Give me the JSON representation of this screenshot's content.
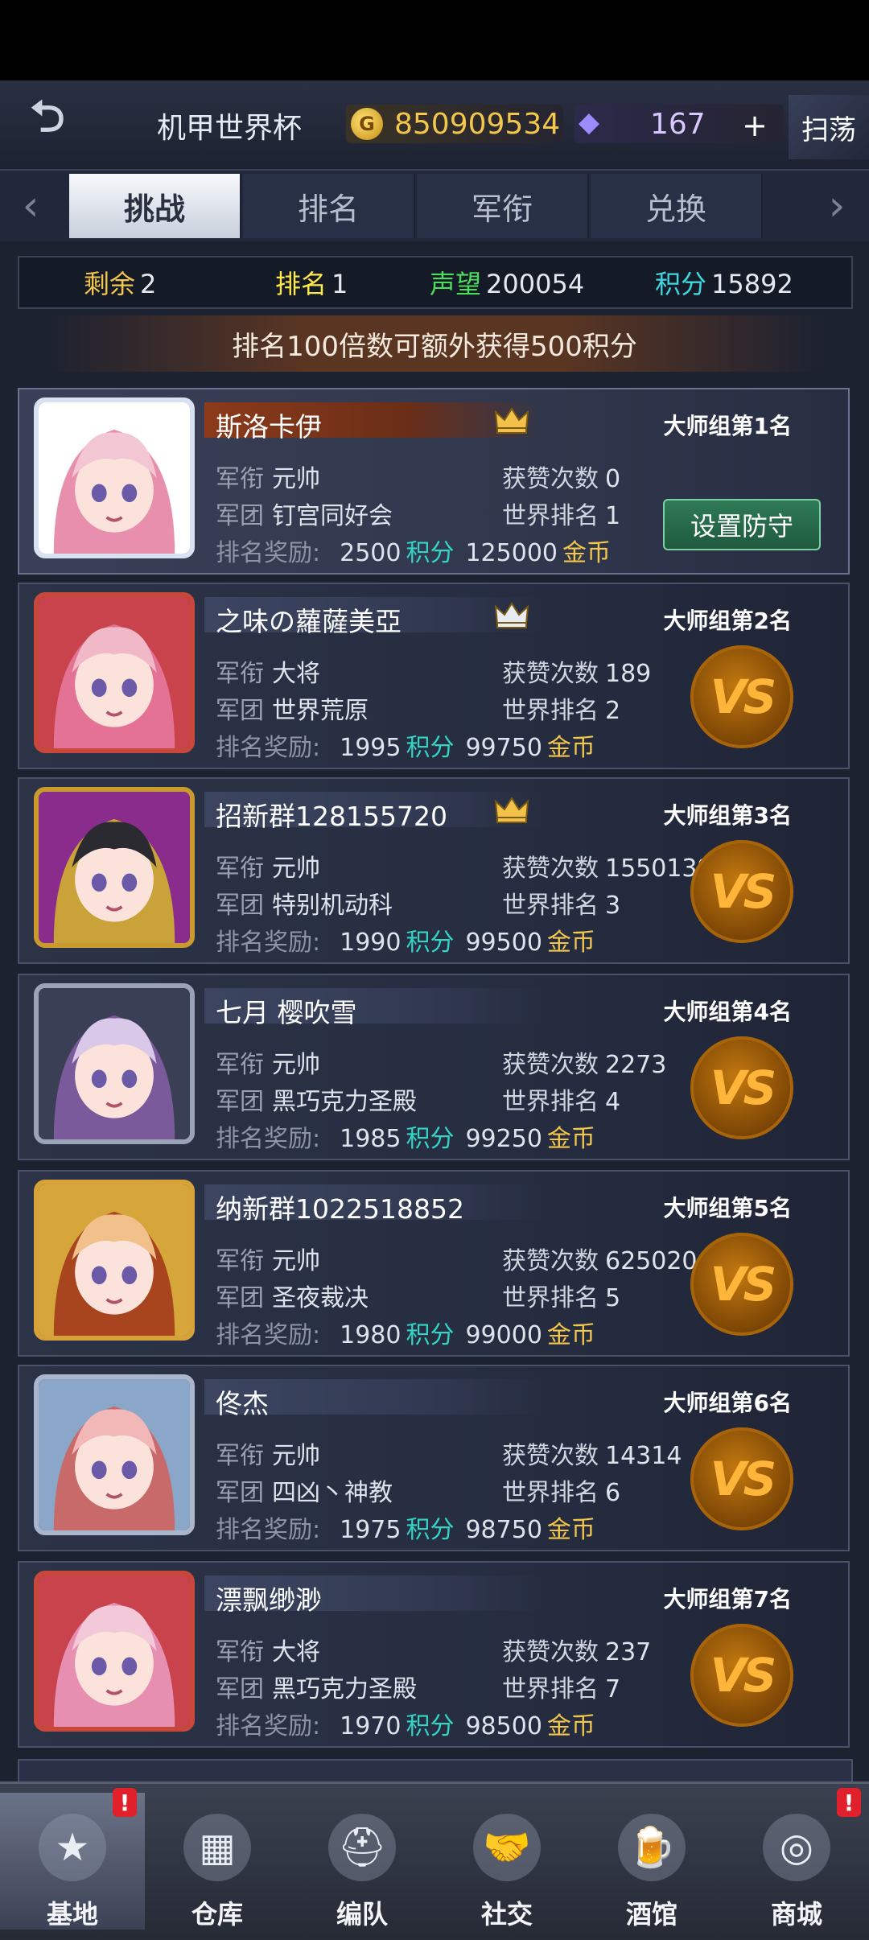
{
  "header": {
    "back_icon": "back-arrow-icon",
    "title": "机甲世界杯",
    "coins": "850909534",
    "gems": "167",
    "plus": "+",
    "sweep": "扫荡"
  },
  "tabs": [
    {
      "label": "挑战",
      "active": true
    },
    {
      "label": "排名",
      "active": false
    },
    {
      "label": "军衔",
      "active": false
    },
    {
      "label": "兑换",
      "active": false
    }
  ],
  "stats": {
    "remaining_label": "剩余",
    "remaining": "2",
    "rank_label": "排名",
    "rank": "1",
    "prestige_label": "声望",
    "prestige": "200054",
    "points_label": "积分",
    "points": "15892"
  },
  "notice": "排名100倍数可额外获得500积分",
  "labels": {
    "rank_title": "军衔",
    "legion": "军团",
    "likes": "获赞次数",
    "world_rank": "世界排名",
    "reward": "排名奖励:",
    "points_unit": "积分",
    "gold_unit": "金币",
    "vs": "VS",
    "set_defense": "设置防守"
  },
  "players": [
    {
      "name": "斯洛卡伊",
      "group": "大师组第1名",
      "title": "元帅",
      "legion": "钉宫同好会",
      "likes": "0",
      "world_rank": "1",
      "reward_points": "2500",
      "reward_gold": "125000",
      "crown": "1"
    },
    {
      "name": "之味の蘿薩美亞",
      "group": "大师组第2名",
      "title": "大将",
      "legion": "世界荒原",
      "likes": "189",
      "world_rank": "2",
      "reward_points": "1995",
      "reward_gold": "99750",
      "crown": "2"
    },
    {
      "name": "招新群128155720",
      "group": "大师组第3名",
      "title": "元帅",
      "legion": "特别机动科",
      "likes": "1550139",
      "world_rank": "3",
      "reward_points": "1990",
      "reward_gold": "99500",
      "crown": "3"
    },
    {
      "name": "七月 樱吹雪",
      "group": "大师组第4名",
      "title": "元帅",
      "legion": "黑巧克力圣殿",
      "likes": "2273",
      "world_rank": "4",
      "reward_points": "1985",
      "reward_gold": "99250"
    },
    {
      "name": "纳新群1022518852",
      "group": "大师组第5名",
      "title": "元帅",
      "legion": "圣夜裁决",
      "likes": "625020",
      "world_rank": "5",
      "reward_points": "1980",
      "reward_gold": "99000"
    },
    {
      "name": "佟杰",
      "group": "大师组第6名",
      "title": "元帅",
      "legion": "四凶丶神教",
      "likes": "14314",
      "world_rank": "6",
      "reward_points": "1975",
      "reward_gold": "98750"
    },
    {
      "name": "漂飘缈渺",
      "group": "大师组第7名",
      "title": "大将",
      "legion": "黑巧克力圣殿",
      "likes": "237",
      "world_rank": "7",
      "reward_points": "1970",
      "reward_gold": "98500"
    }
  ],
  "nav": [
    {
      "label": "基地",
      "icon": "base-icon",
      "active": true,
      "badge": "!"
    },
    {
      "label": "仓库",
      "icon": "warehouse-icon"
    },
    {
      "label": "编队",
      "icon": "formation-icon"
    },
    {
      "label": "社交",
      "icon": "handshake-icon"
    },
    {
      "label": "酒馆",
      "icon": "tavern-icon"
    },
    {
      "label": "商城",
      "icon": "shop-icon",
      "badge": "!"
    }
  ],
  "colors": {
    "points": "#33d6c6",
    "gold": "#f3c64c",
    "remaining": "#f3c64c",
    "rank": "#ffe94a",
    "prestige": "#4ade5a",
    "points_stat": "#3fd7e0"
  }
}
